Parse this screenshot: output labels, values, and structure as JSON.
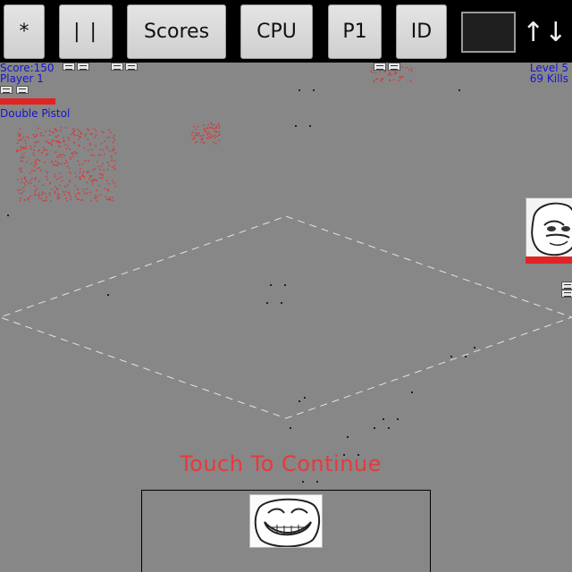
{
  "toolbar": {
    "star_label": "*",
    "pause_label": "| |",
    "scores_label": "Scores",
    "cpu_label": "CPU",
    "p1_label": "P1",
    "id_label": "ID",
    "swatch_color": "#1e1e1e",
    "sort_icon": "↑↓"
  },
  "hud": {
    "score": "Score:150",
    "player": "Player 1",
    "weapon": "Double Pistol",
    "level": "Level 5",
    "kills": "69 Kills",
    "text_color": "#1414d2",
    "health_color": "#e02424"
  },
  "overlay": {
    "message": "Touch To Continue",
    "message_color": "#e8393b"
  },
  "icons": {
    "enemy": "me-gusta-face-icon",
    "player": "troll-face-icon",
    "mini": "mini-face-icon"
  }
}
